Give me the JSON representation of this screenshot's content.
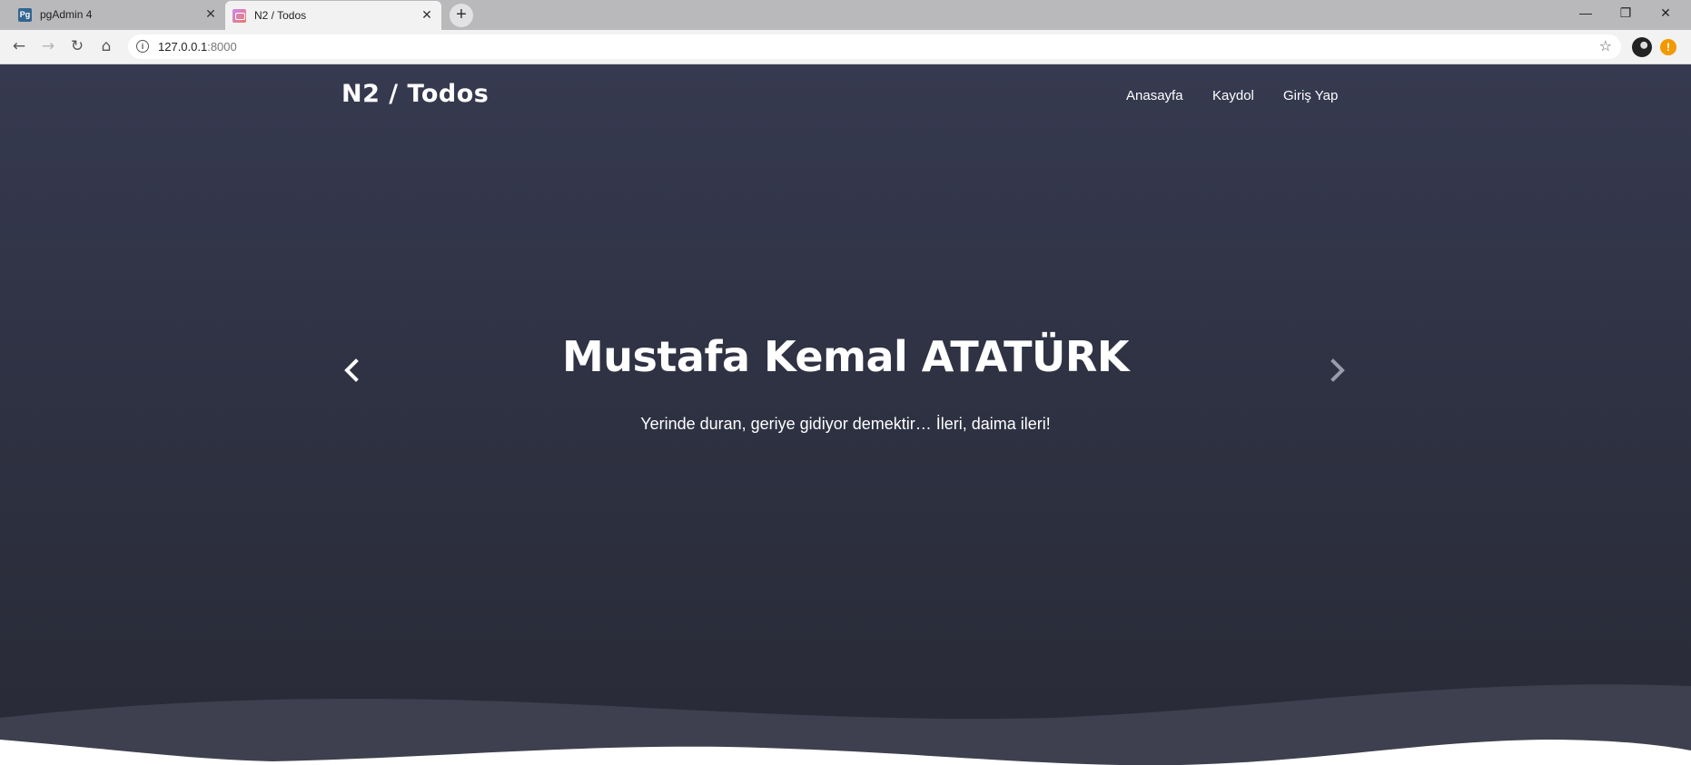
{
  "browser": {
    "tabs": [
      {
        "title": "pgAdmin 4",
        "favicon": "pgadmin-icon",
        "active": false
      },
      {
        "title": "N2 / Todos",
        "favicon": "n2-todos-icon",
        "active": true
      }
    ],
    "new_tab": "+",
    "address": {
      "host": "127.0.0.1",
      "port": ":8000"
    },
    "window_controls": {
      "minimize": "—",
      "restore": "❐",
      "close": "✕"
    },
    "alert_badge": "!"
  },
  "site": {
    "brand": "N2 / Todos",
    "nav": [
      {
        "label": "Anasayfa"
      },
      {
        "label": "Kaydol"
      },
      {
        "label": "Giriş Yap"
      }
    ]
  },
  "hero": {
    "headline": "Mustafa Kemal ATATÜRK",
    "quote": "Yerinde duran, geriye gidiyor demektir… İleri, daima ileri!",
    "prev_icon": "chevron-left-icon",
    "next_icon": "chevron-right-icon"
  },
  "colors": {
    "hero_top": "#363a50",
    "hero_bottom": "#282a36",
    "wave_back": "#3f404f",
    "page_bg": "#ffffff"
  }
}
